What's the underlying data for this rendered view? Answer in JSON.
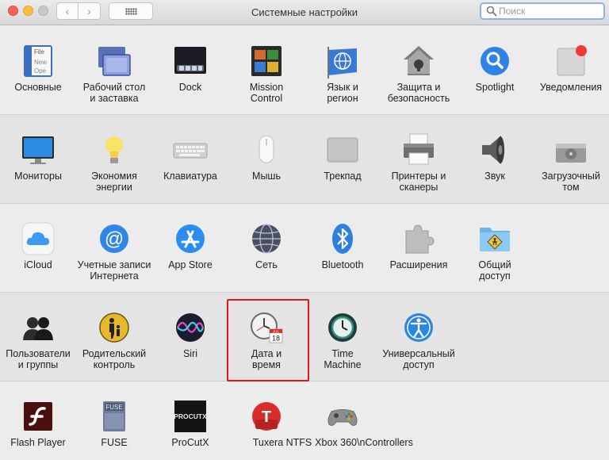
{
  "window": {
    "title": "Системные настройки",
    "search_placeholder": "Поиск"
  },
  "nav": {
    "back": "‹",
    "forward": "›"
  },
  "sections": [
    {
      "items": [
        {
          "id": "general",
          "label": "Основные",
          "icon": "general-icon",
          "icon_text": [
            "File",
            "New",
            "Ope"
          ]
        },
        {
          "id": "desktop",
          "label": "Рабочий стол\nи заставка",
          "icon": "desktop-screensaver-icon"
        },
        {
          "id": "dock",
          "label": "Dock",
          "icon": "dock-icon"
        },
        {
          "id": "mission",
          "label": "Mission\nControl",
          "icon": "mission-control-icon"
        },
        {
          "id": "language",
          "label": "Язык и\nрегион",
          "icon": "language-region-icon"
        },
        {
          "id": "security",
          "label": "Защита и\nбезопасность",
          "icon": "security-house-icon"
        },
        {
          "id": "spotlight",
          "label": "Spotlight",
          "icon": "spotlight-icon"
        },
        {
          "id": "notifications",
          "label": "Уведомления",
          "icon": "notifications-icon"
        }
      ]
    },
    {
      "items": [
        {
          "id": "displays",
          "label": "Мониторы",
          "icon": "display-monitor-icon"
        },
        {
          "id": "energy",
          "label": "Экономия\nэнергии",
          "icon": "lightbulb-icon"
        },
        {
          "id": "keyboard",
          "label": "Клавиатура",
          "icon": "keyboard-icon"
        },
        {
          "id": "mouse",
          "label": "Мышь",
          "icon": "mouse-icon"
        },
        {
          "id": "trackpad",
          "label": "Трекпад",
          "icon": "trackpad-icon"
        },
        {
          "id": "printers",
          "label": "Принтеры и\nсканеры",
          "icon": "printer-icon"
        },
        {
          "id": "sound",
          "label": "Звук",
          "icon": "speaker-icon"
        },
        {
          "id": "startup",
          "label": "Загрузочный\nтом",
          "icon": "hard-drive-icon"
        }
      ]
    },
    {
      "items": [
        {
          "id": "icloud",
          "label": "iCloud",
          "icon": "icloud-icon"
        },
        {
          "id": "accounts",
          "label": "Учетные записи\nИнтернета",
          "icon": "internet-accounts-icon"
        },
        {
          "id": "appstore",
          "label": "App Store",
          "icon": "app-store-icon"
        },
        {
          "id": "network",
          "label": "Сеть",
          "icon": "network-globe-icon"
        },
        {
          "id": "bluetooth",
          "label": "Bluetooth",
          "icon": "bluetooth-icon"
        },
        {
          "id": "extensions",
          "label": "Расширения",
          "icon": "puzzle-extensions-icon"
        },
        {
          "id": "sharing",
          "label": "Общий\nдоступ",
          "icon": "sharing-folder-icon"
        }
      ]
    },
    {
      "items": [
        {
          "id": "users",
          "label": "Пользователи\nи группы",
          "icon": "users-groups-icon"
        },
        {
          "id": "parental",
          "label": "Родительский\nконтроль",
          "icon": "parental-controls-icon"
        },
        {
          "id": "siri",
          "label": "Siri",
          "icon": "siri-icon"
        },
        {
          "id": "datetime",
          "label": "Дата и\nвремя",
          "icon": "clock-calendar-icon",
          "icon_text": [
            "JUL",
            "18"
          ]
        },
        {
          "id": "timemachine",
          "label": "Time\nMachine",
          "icon": "time-machine-icon"
        },
        {
          "id": "accessibility",
          "label": "Универсальный\nдоступ",
          "icon": "accessibility-icon"
        }
      ]
    },
    {
      "items": [
        {
          "id": "flash",
          "label": "Flash Player",
          "icon": "flash-player-icon"
        },
        {
          "id": "fuse",
          "label": "FUSE",
          "icon": "fuse-icon",
          "icon_text": [
            "FUSE"
          ]
        },
        {
          "id": "procutx",
          "label": "ProCutX",
          "icon": "procutx-icon",
          "icon_text": [
            "PROCUTX"
          ]
        },
        {
          "id": "tuxera",
          "label": "Tuxera NTFS",
          "icon": "tuxera-ntfs-icon",
          "icon_text": [
            "T"
          ]
        },
        {
          "id": "xbox",
          "label": "Xbox 360\\nControllers",
          "icon": "gamepad-icon"
        }
      ]
    }
  ]
}
